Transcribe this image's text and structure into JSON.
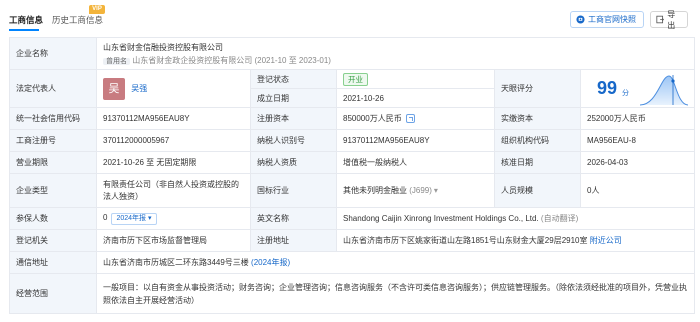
{
  "tabs": [
    {
      "label": "工商信息"
    },
    {
      "label": "历史工商信息"
    }
  ],
  "vip_label": "VIP",
  "buttons": {
    "official_snapshot": "工商官网快照",
    "export": "导出"
  },
  "rows": {
    "company_name_label": "企业名称",
    "company_name": "山东省财金信融投资控股有限公司",
    "former_name_tag": "曾用名",
    "former_name": "山东省财金政企投资控股有限公司 (2021-10 至 2023-01)",
    "legal_rep_label": "法定代表人",
    "avatar_char": "吴",
    "legal_rep": "吴强",
    "reg_status_label": "登记状态",
    "reg_status": "开业",
    "found_date_label": "成立日期",
    "found_date": "2021-10-26",
    "tianyan_label": "天眼评分",
    "tianyan_score": "99",
    "tianyan_unit": "分",
    "credit_code_label": "统一社会信用代码",
    "credit_code": "91370112MA956EAU8Y",
    "reg_capital_label": "注册资本",
    "reg_capital": "850000万人民币",
    "paid_capital_label": "实缴资本",
    "paid_capital": "252000万人民币",
    "biz_reg_no_label": "工商注册号",
    "biz_reg_no": "370112000005967",
    "taxpayer_id_label": "纳税人识别号",
    "taxpayer_id": "91370112MA956EAU8Y",
    "org_code_label": "组织机构代码",
    "org_code": "MA956EAU-8",
    "term_label": "营业期限",
    "term": "2021-10-26 至 无固定期限",
    "taxpayer_qual_label": "纳税人资质",
    "taxpayer_qual": "增值税一般纳税人",
    "approve_date_label": "核准日期",
    "approve_date": "2026-04-03",
    "company_type_label": "企业类型",
    "company_type": "有限责任公司（非自然人投资或控股的法人独资）",
    "industry_label": "国标行业",
    "industry": "其他未列明金融业",
    "industry_code": "(J699)",
    "staff_size_label": "人员规模",
    "staff_size": "0人",
    "insured_label": "参保人数",
    "insured": "0",
    "insured_badge": "2024年报",
    "en_name_label": "英文名称",
    "en_name": "Shandong Caijin Xinrong Investment Holdings Co., Ltd.",
    "en_name_note": "(自动翻译)",
    "reg_authority_label": "登记机关",
    "reg_authority": "济南市历下区市场监督管理局",
    "reg_address_label": "注册地址",
    "reg_address": "山东省济南市历下区姚家街道山左路1851号山东财金大厦29层2910室",
    "nearby_link": "附近公司",
    "mail_address_label": "通信地址",
    "mail_address": "山东省济南市历城区二环东路3449号三楼",
    "mail_address_note": "(2024年报)",
    "biz_scope_label": "经营范围",
    "biz_scope": "一般项目：以自有资金从事投资活动；财务咨询；企业管理咨询；信息咨询服务（不含许可类信息咨询服务）；供应链管理服务。（除依法须经批准的项目外，凭营业执照依法自主开展经营活动）"
  },
  "colors": {
    "accent": "#1768c9",
    "label_bg": "#f2f6fb",
    "status_green": "#2f9a3c",
    "avatar": "#c87b80"
  }
}
